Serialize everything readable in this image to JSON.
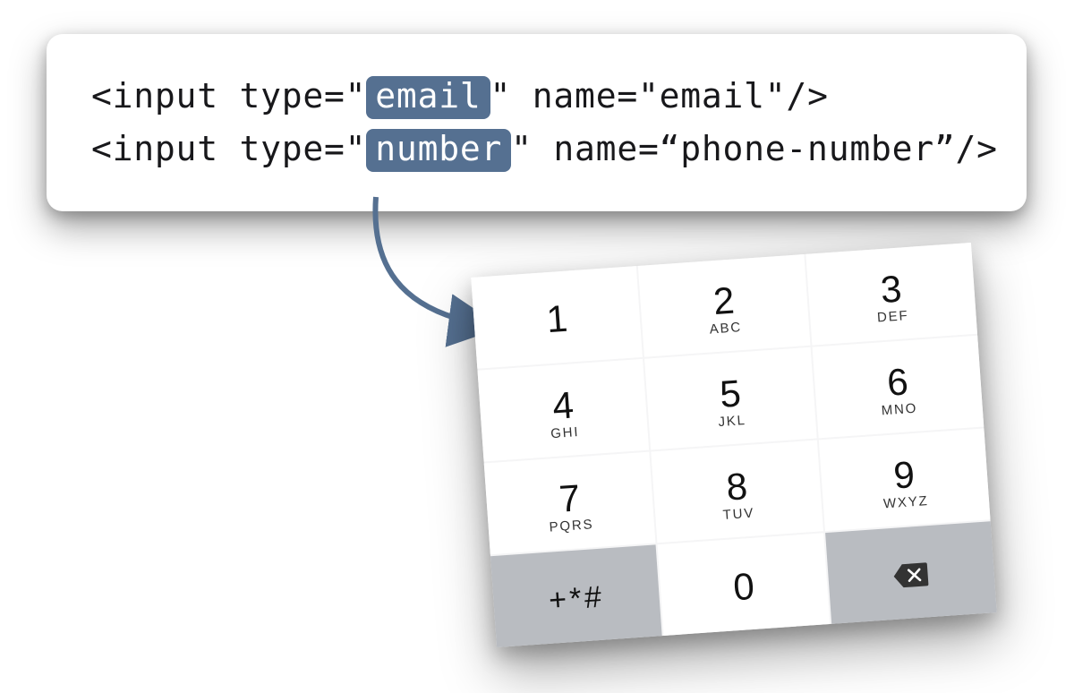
{
  "code": {
    "line1": {
      "prefix": "<input type=\"",
      "highlight": "email",
      "suffix": "\" name=\"email\"/>"
    },
    "line2": {
      "prefix": "<input type=\"",
      "highlight": "number",
      "suffix": "\" name=“phone-number”/>"
    }
  },
  "keypad": {
    "keys": [
      {
        "num": "1",
        "sub": ""
      },
      {
        "num": "2",
        "sub": "ABC"
      },
      {
        "num": "3",
        "sub": "DEF"
      },
      {
        "num": "4",
        "sub": "GHI"
      },
      {
        "num": "5",
        "sub": "JKL"
      },
      {
        "num": "6",
        "sub": "MNO"
      },
      {
        "num": "7",
        "sub": "PQRS"
      },
      {
        "num": "8",
        "sub": "TUV"
      },
      {
        "num": "9",
        "sub": "WXYZ"
      }
    ],
    "symbols": "+*#",
    "zero": "0"
  }
}
